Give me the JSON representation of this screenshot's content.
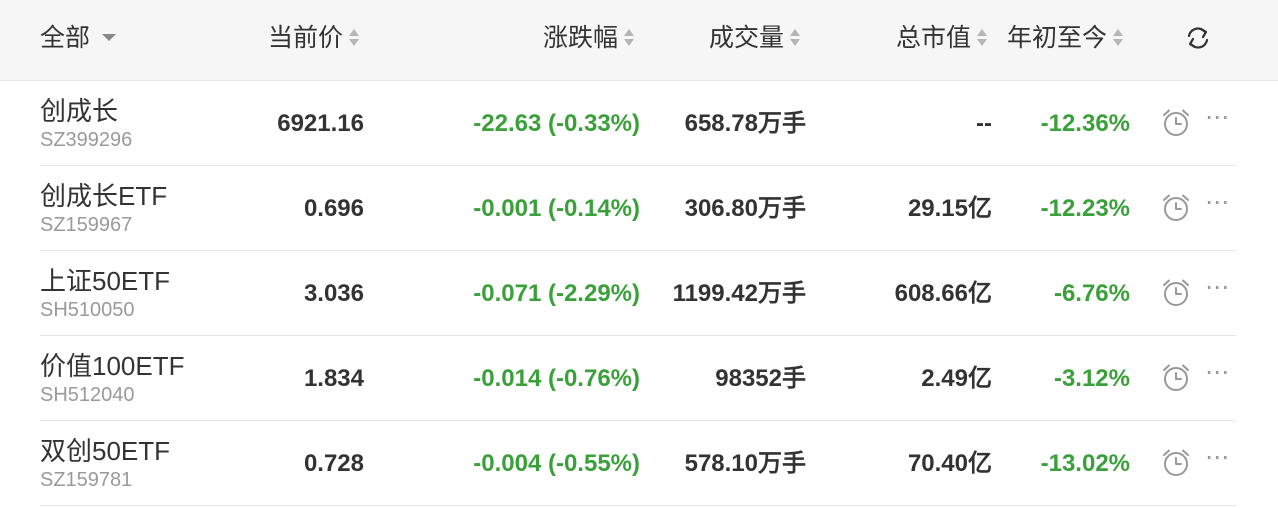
{
  "header": {
    "all_label": "全部",
    "price_label": "当前价",
    "change_label": "涨跌幅",
    "volume_label": "成交量",
    "market_cap_label": "总市值",
    "ytd_label": "年初至今",
    "refresh_icon": "refresh-icon"
  },
  "rows": [
    {
      "name": "创成长",
      "code": "SZ399296",
      "price": "6921.16",
      "change": "-22.63 (-0.33%)",
      "volume": "658.78万手",
      "market_cap": "--",
      "ytd": "-12.36%"
    },
    {
      "name": "创成长ETF",
      "code": "SZ159967",
      "price": "0.696",
      "change": "-0.001 (-0.14%)",
      "volume": "306.80万手",
      "market_cap": "29.15亿",
      "ytd": "-12.23%"
    },
    {
      "name": "上证50ETF",
      "code": "SH510050",
      "price": "3.036",
      "change": "-0.071 (-2.29%)",
      "volume": "1199.42万手",
      "market_cap": "608.66亿",
      "ytd": "-6.76%"
    },
    {
      "name": "价值100ETF",
      "code": "SH512040",
      "price": "1.834",
      "change": "-0.014 (-0.76%)",
      "volume": "98352手",
      "market_cap": "2.49亿",
      "ytd": "-3.12%"
    },
    {
      "name": "双创50ETF",
      "code": "SZ159781",
      "price": "0.728",
      "change": "-0.004 (-0.55%)",
      "volume": "578.10万手",
      "market_cap": "70.40亿",
      "ytd": "-13.02%"
    }
  ],
  "more_glyph": "⋯",
  "colors": {
    "negative": "#3aa03a",
    "text": "#333333",
    "muted": "#9a9a9a",
    "header_bg": "#f6f6f6"
  }
}
